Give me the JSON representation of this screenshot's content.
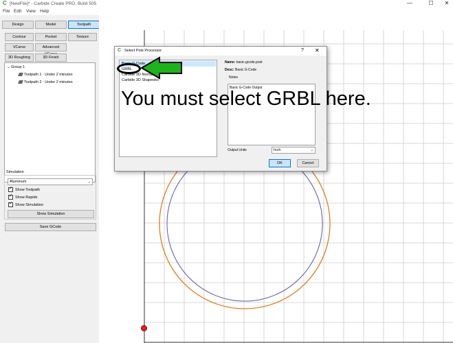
{
  "window": {
    "title": "[NewFile]* - Carbide Create PRO, Build 505",
    "app_icon": "carbide-c-icon"
  },
  "menu": [
    "File",
    "Edit",
    "View",
    "Help"
  ],
  "mode_tabs": {
    "design": "Design",
    "model": "Model",
    "toolpath": "Toolpath",
    "active": "Toolpath"
  },
  "toolpath_buttons": {
    "contour": "Contour",
    "pocket": "Pocket",
    "texture": "Texture",
    "vcarve": "VCarve",
    "advanced_vcarve": "Advanced VCarve",
    "roughing_3d": "3D Roughing",
    "finish_3d": "3D Finish"
  },
  "tree": {
    "group": "Group 1",
    "items": [
      "Toolpath 1 - Under 2 minutes",
      "Toolpath 2 - Under 2 minutes"
    ]
  },
  "simulation": {
    "label": "Simulation",
    "material": "Aluminum",
    "show_toolpath": "Show Toolpath",
    "show_rapids": "Show Rapids",
    "show_simulation": "Show Simulation",
    "show_simulation_button": "Show Simulation"
  },
  "save_gcode": "Save GCode",
  "dialog": {
    "title": "Select Post Processor",
    "help": "?",
    "close": "✕",
    "processors": [
      "Basic G-Code",
      "GRBL",
      "Carbide 3D Nomad",
      "Carbide 3D Shapeoko"
    ],
    "selected_index": 0,
    "name_label": "Name:",
    "name_value": "basic-gcode.post",
    "desc_label": "Desc:",
    "desc_value": "Basic G-Code",
    "notes_label": "Notes",
    "notes_value": "Basic G-Code Output",
    "output_units_label": "Output Units",
    "output_units_value": "Inch",
    "ok": "OK",
    "cancel": "Cancel"
  },
  "annotation": {
    "text": "You must select GRBL here.",
    "arrow_color": "#1db31d"
  },
  "colors": {
    "outer_circle": "#e07b1a",
    "inner_circle": "#5555aa",
    "grid": "#cccccc",
    "accent": "#0078d7"
  }
}
